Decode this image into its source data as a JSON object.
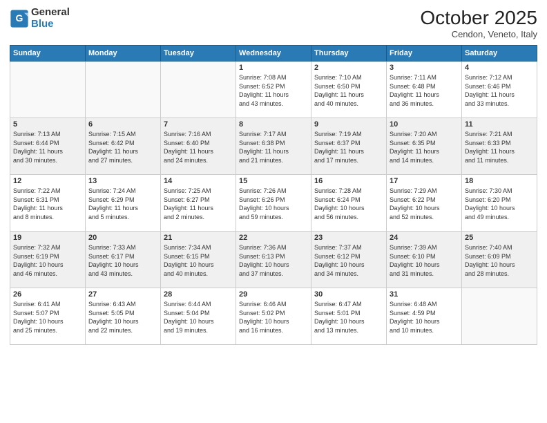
{
  "header": {
    "logo_general": "General",
    "logo_blue": "Blue",
    "month_title": "October 2025",
    "subtitle": "Cendon, Veneto, Italy"
  },
  "days_of_week": [
    "Sunday",
    "Monday",
    "Tuesday",
    "Wednesday",
    "Thursday",
    "Friday",
    "Saturday"
  ],
  "weeks": [
    [
      {
        "day": "",
        "info": ""
      },
      {
        "day": "",
        "info": ""
      },
      {
        "day": "",
        "info": ""
      },
      {
        "day": "1",
        "info": "Sunrise: 7:08 AM\nSunset: 6:52 PM\nDaylight: 11 hours\nand 43 minutes."
      },
      {
        "day": "2",
        "info": "Sunrise: 7:10 AM\nSunset: 6:50 PM\nDaylight: 11 hours\nand 40 minutes."
      },
      {
        "day": "3",
        "info": "Sunrise: 7:11 AM\nSunset: 6:48 PM\nDaylight: 11 hours\nand 36 minutes."
      },
      {
        "day": "4",
        "info": "Sunrise: 7:12 AM\nSunset: 6:46 PM\nDaylight: 11 hours\nand 33 minutes."
      }
    ],
    [
      {
        "day": "5",
        "info": "Sunrise: 7:13 AM\nSunset: 6:44 PM\nDaylight: 11 hours\nand 30 minutes."
      },
      {
        "day": "6",
        "info": "Sunrise: 7:15 AM\nSunset: 6:42 PM\nDaylight: 11 hours\nand 27 minutes."
      },
      {
        "day": "7",
        "info": "Sunrise: 7:16 AM\nSunset: 6:40 PM\nDaylight: 11 hours\nand 24 minutes."
      },
      {
        "day": "8",
        "info": "Sunrise: 7:17 AM\nSunset: 6:38 PM\nDaylight: 11 hours\nand 21 minutes."
      },
      {
        "day": "9",
        "info": "Sunrise: 7:19 AM\nSunset: 6:37 PM\nDaylight: 11 hours\nand 17 minutes."
      },
      {
        "day": "10",
        "info": "Sunrise: 7:20 AM\nSunset: 6:35 PM\nDaylight: 11 hours\nand 14 minutes."
      },
      {
        "day": "11",
        "info": "Sunrise: 7:21 AM\nSunset: 6:33 PM\nDaylight: 11 hours\nand 11 minutes."
      }
    ],
    [
      {
        "day": "12",
        "info": "Sunrise: 7:22 AM\nSunset: 6:31 PM\nDaylight: 11 hours\nand 8 minutes."
      },
      {
        "day": "13",
        "info": "Sunrise: 7:24 AM\nSunset: 6:29 PM\nDaylight: 11 hours\nand 5 minutes."
      },
      {
        "day": "14",
        "info": "Sunrise: 7:25 AM\nSunset: 6:27 PM\nDaylight: 11 hours\nand 2 minutes."
      },
      {
        "day": "15",
        "info": "Sunrise: 7:26 AM\nSunset: 6:26 PM\nDaylight: 10 hours\nand 59 minutes."
      },
      {
        "day": "16",
        "info": "Sunrise: 7:28 AM\nSunset: 6:24 PM\nDaylight: 10 hours\nand 56 minutes."
      },
      {
        "day": "17",
        "info": "Sunrise: 7:29 AM\nSunset: 6:22 PM\nDaylight: 10 hours\nand 52 minutes."
      },
      {
        "day": "18",
        "info": "Sunrise: 7:30 AM\nSunset: 6:20 PM\nDaylight: 10 hours\nand 49 minutes."
      }
    ],
    [
      {
        "day": "19",
        "info": "Sunrise: 7:32 AM\nSunset: 6:19 PM\nDaylight: 10 hours\nand 46 minutes."
      },
      {
        "day": "20",
        "info": "Sunrise: 7:33 AM\nSunset: 6:17 PM\nDaylight: 10 hours\nand 43 minutes."
      },
      {
        "day": "21",
        "info": "Sunrise: 7:34 AM\nSunset: 6:15 PM\nDaylight: 10 hours\nand 40 minutes."
      },
      {
        "day": "22",
        "info": "Sunrise: 7:36 AM\nSunset: 6:13 PM\nDaylight: 10 hours\nand 37 minutes."
      },
      {
        "day": "23",
        "info": "Sunrise: 7:37 AM\nSunset: 6:12 PM\nDaylight: 10 hours\nand 34 minutes."
      },
      {
        "day": "24",
        "info": "Sunrise: 7:39 AM\nSunset: 6:10 PM\nDaylight: 10 hours\nand 31 minutes."
      },
      {
        "day": "25",
        "info": "Sunrise: 7:40 AM\nSunset: 6:09 PM\nDaylight: 10 hours\nand 28 minutes."
      }
    ],
    [
      {
        "day": "26",
        "info": "Sunrise: 6:41 AM\nSunset: 5:07 PM\nDaylight: 10 hours\nand 25 minutes."
      },
      {
        "day": "27",
        "info": "Sunrise: 6:43 AM\nSunset: 5:05 PM\nDaylight: 10 hours\nand 22 minutes."
      },
      {
        "day": "28",
        "info": "Sunrise: 6:44 AM\nSunset: 5:04 PM\nDaylight: 10 hours\nand 19 minutes."
      },
      {
        "day": "29",
        "info": "Sunrise: 6:46 AM\nSunset: 5:02 PM\nDaylight: 10 hours\nand 16 minutes."
      },
      {
        "day": "30",
        "info": "Sunrise: 6:47 AM\nSunset: 5:01 PM\nDaylight: 10 hours\nand 13 minutes."
      },
      {
        "day": "31",
        "info": "Sunrise: 6:48 AM\nSunset: 4:59 PM\nDaylight: 10 hours\nand 10 minutes."
      },
      {
        "day": "",
        "info": ""
      }
    ]
  ]
}
